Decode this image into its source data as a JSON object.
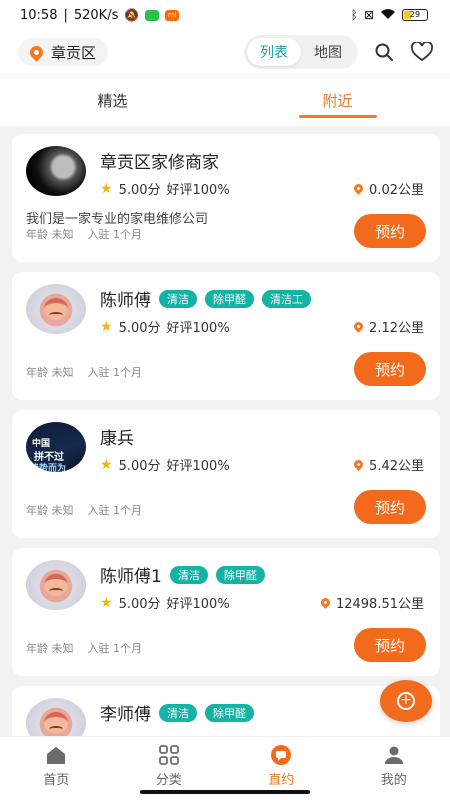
{
  "status_bar": {
    "time": "10:58",
    "speed": "520K/s",
    "battery": "29"
  },
  "header": {
    "location": "章贡区",
    "view_toggle": [
      {
        "label": "列表",
        "active": true
      },
      {
        "label": "地图",
        "active": false
      }
    ],
    "icons": [
      "search-icon",
      "heart-icon"
    ]
  },
  "tabs": [
    {
      "label": "精选",
      "active": false
    },
    {
      "label": "附近",
      "active": true
    }
  ],
  "providers": [
    {
      "name": "章贡区家修商家",
      "tags": [],
      "score": "5.00分",
      "praise": "好评100%",
      "distance": "0.02公里",
      "description": "我们是一家专业的家电维修公司",
      "age": "年龄 未知",
      "joined": "入驻 1个月",
      "button": "预约",
      "avatar": "moon"
    },
    {
      "name": "陈师傅",
      "tags": [
        "清洁",
        "除甲醛",
        "清洁工"
      ],
      "score": "5.00分",
      "praise": "好评100%",
      "distance": "2.12公里",
      "description": "",
      "age": "年龄 未知",
      "joined": "入驻 1个月",
      "button": "预约",
      "avatar": "face"
    },
    {
      "name": "康兵",
      "tags": [],
      "score": "5.00分",
      "praise": "好评100%",
      "distance": "5.42公里",
      "description": "",
      "age": "年龄 未知",
      "joined": "入驻 1个月",
      "button": "预约",
      "avatar": "text"
    },
    {
      "name": "陈师傅1",
      "tags": [
        "清洁",
        "除甲醛"
      ],
      "score": "5.00分",
      "praise": "好评100%",
      "distance": "12498.51公里",
      "description": "",
      "age": "年龄 未知",
      "joined": "入驻 1个月",
      "button": "预约",
      "avatar": "face"
    },
    {
      "name": "李师傅",
      "tags": [
        "清洁",
        "除甲醛"
      ],
      "score": "",
      "praise": "",
      "distance": "",
      "description": "",
      "age": "",
      "joined": "",
      "button": "",
      "avatar": "face"
    }
  ],
  "avatar_text": {
    "line1": "中国",
    "line2": "拼不过",
    "line3": "趋势而为"
  },
  "fab": {
    "icon": "plus-circle-icon"
  },
  "bottom_nav": [
    {
      "label": "首页",
      "icon": "home-icon",
      "active": false
    },
    {
      "label": "分类",
      "icon": "grid-icon",
      "active": false
    },
    {
      "label": "直约",
      "icon": "chat-icon",
      "active": true
    },
    {
      "label": "我的",
      "icon": "user-icon",
      "active": false
    }
  ],
  "colors": {
    "accent": "#f26b1d",
    "tag": "#15b3a4",
    "toggle_active": "#1aa3a3",
    "star": "#f5b40a"
  }
}
